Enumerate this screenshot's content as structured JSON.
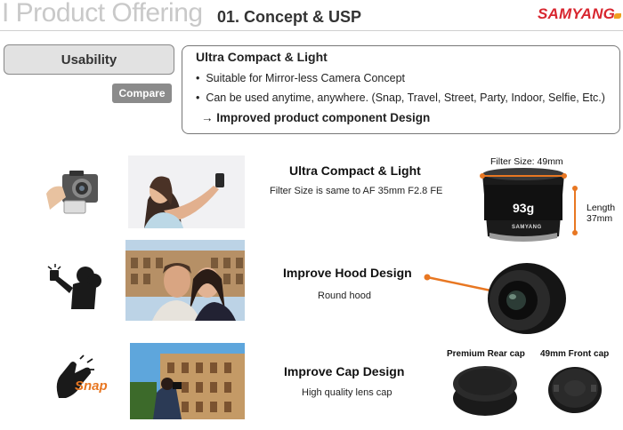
{
  "header": {
    "section_title": "I Product Offering",
    "subtitle": "01. Concept & USP",
    "brand": "SAMYANG"
  },
  "sidebar": {
    "category_label": "Usability",
    "compare_label": "Compare"
  },
  "feature_box": {
    "title": "Ultra Compact & Light",
    "bullets": [
      "Suitable for Mirror-less Camera Concept",
      "Can be used anytime, anywhere. (Snap, Travel, Street, Party, Indoor, Selfie, Etc.)"
    ],
    "conclusion_arrow": "→",
    "conclusion": "Improved product component Design"
  },
  "rows": [
    {
      "title": "Ultra Compact & Light",
      "description": "Filter Size is same to AF 35mm F2.8 FE",
      "icon": "camera-in-hand-icon",
      "photo": "selfie-woman-photo"
    },
    {
      "title": "Improve Hood Design",
      "description": "Round hood",
      "icon": "selfie-pose-icon",
      "photo": "couple-selfie-colosseum-photo"
    },
    {
      "title": "Improve Cap Design",
      "description": "High quality lens cap",
      "icon": "snap-fingers-icon",
      "photo": "traveler-colosseum-photo"
    }
  ],
  "product_callouts": {
    "filter_size": "Filter Size: 49mm",
    "weight": "93g",
    "length_label": "Length",
    "length_value": "37mm",
    "lens_brand": "SAMYANG",
    "rear_cap": "Premium Rear cap",
    "front_cap": "49mm Front cap",
    "snap_text": "Snap"
  },
  "colors": {
    "brand_red": "#d8262f",
    "callout_orange": "#e87722",
    "panel_gray": "#e2e2e2",
    "button_gray": "#8b8b8b"
  }
}
